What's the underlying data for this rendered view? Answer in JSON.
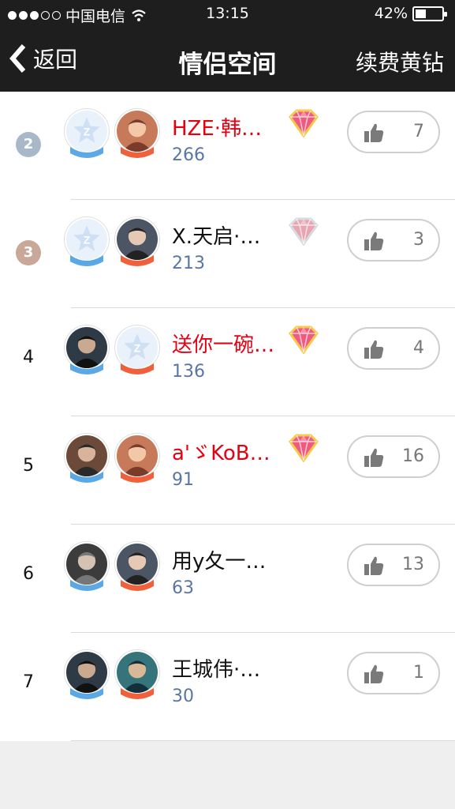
{
  "status_bar": {
    "carrier": "中国电信",
    "time": "13:15",
    "battery_text": "42%",
    "battery_level": 0.42,
    "signal_dots_filled": 3,
    "signal_dots_total": 5
  },
  "navbar": {
    "back_label": "返回",
    "title": "情侣空间",
    "right_action": "续费黄钻"
  },
  "colors": {
    "header_bg": "#1e1e1e",
    "vip_name": "#e60012",
    "normal_name": "#111111",
    "score": "#5a76a0",
    "rank2_badge": "#a9b8c8",
    "rank3_badge": "#c9a89a"
  },
  "rows": [
    {
      "rank": "2",
      "badge": true,
      "badge_color": "#a9b8c8",
      "name": "HZE·韩…",
      "vip": true,
      "score": "266",
      "likes": "7",
      "diamond": "pink"
    },
    {
      "rank": "3",
      "badge": true,
      "badge_color": "#c9a89a",
      "name": "X.天启·…",
      "vip": false,
      "score": "213",
      "likes": "3",
      "diamond": "mixed"
    },
    {
      "rank": "4",
      "badge": false,
      "name": "送你一碗…",
      "vip": true,
      "score": "136",
      "likes": "4",
      "diamond": "pink"
    },
    {
      "rank": "5",
      "badge": false,
      "name": "a'ゞKoB…",
      "vip": true,
      "score": "91",
      "likes": "16",
      "diamond": "pink"
    },
    {
      "rank": "6",
      "badge": false,
      "name": "用y夂一…",
      "vip": false,
      "score": "63",
      "likes": "13",
      "diamond": "none"
    },
    {
      "rank": "7",
      "badge": false,
      "name": "王城伟·…",
      "vip": false,
      "score": "30",
      "likes": "1",
      "diamond": "none"
    }
  ]
}
